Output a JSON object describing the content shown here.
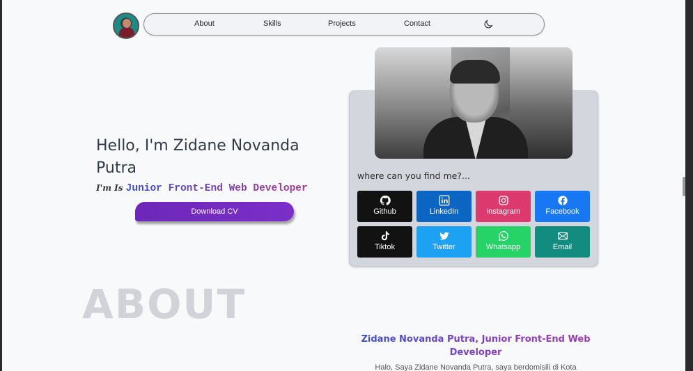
{
  "nav": {
    "items": [
      {
        "label": "About"
      },
      {
        "label": "Skills"
      },
      {
        "label": "Projects"
      },
      {
        "label": "Contact"
      }
    ]
  },
  "hero": {
    "title": "Hello, I'm Zidane Novanda Putra",
    "prefix": "I'm Is",
    "role": "Junior Front-End Web Developer",
    "cv_button": "Download CV"
  },
  "contact_card": {
    "heading": "where can you find me?...",
    "links": [
      {
        "label": "Github",
        "icon": "github-icon",
        "color": "#121212"
      },
      {
        "label": "LinkedIn",
        "icon": "linkedin-icon",
        "color": "#0a66c2"
      },
      {
        "label": "Instagram",
        "icon": "instagram-icon",
        "color": "#dc3a6e"
      },
      {
        "label": "Facebook",
        "icon": "facebook-icon",
        "color": "#1877f2"
      },
      {
        "label": "Tiktok",
        "icon": "tiktok-icon",
        "color": "#121212"
      },
      {
        "label": "Twitter",
        "icon": "twitter-icon",
        "color": "#1da1f2"
      },
      {
        "label": "Whatsapp",
        "icon": "whatsapp-icon",
        "color": "#25d366"
      },
      {
        "label": "Email",
        "icon": "mail-icon",
        "color": "#128c7e"
      }
    ]
  },
  "about": {
    "heading": "ABOUT",
    "title": "Zidane Novanda Putra, Junior Front-End Web Developer",
    "body": "Halo, Saya Zidane Novanda Putra, saya berdomisili di Kota"
  }
}
